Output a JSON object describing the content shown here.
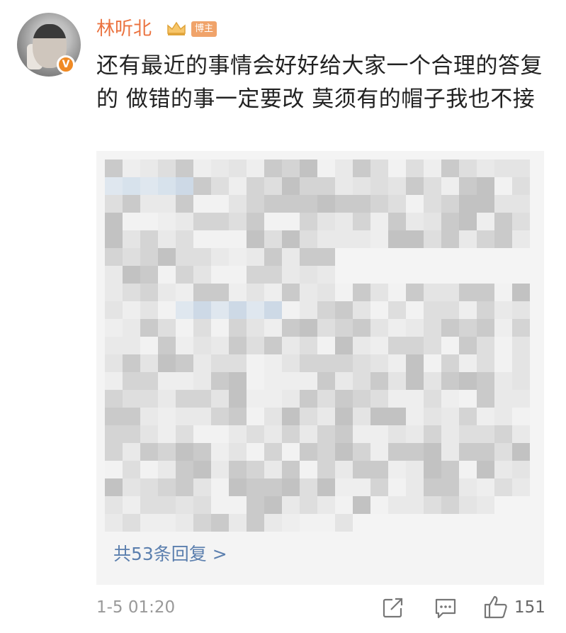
{
  "post": {
    "username": "林听北",
    "role_badge": "博主",
    "verified_badge": "V",
    "text": "还有最近的事情会好好给大家一个合理的答复的 做错的事一定要改 莫须有的帽子我也不接",
    "replies_link": "共53条回复 >",
    "timestamp": "1-5 01:20",
    "like_count": "151"
  },
  "colors": {
    "username": "#eb7340",
    "link": "#5b7fae",
    "badge": "#f0a36a",
    "verified": "#f08a24",
    "quote_bg": "#f4f4f4"
  },
  "icons": [
    "crown-icon",
    "share-icon",
    "comment-icon",
    "like-icon"
  ]
}
